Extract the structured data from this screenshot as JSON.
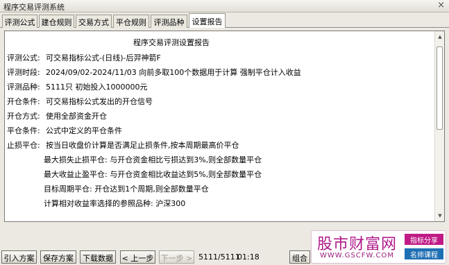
{
  "window": {
    "title": "程序交易评测系统",
    "close": "×"
  },
  "tabs": [
    {
      "label": "评测公式"
    },
    {
      "label": "建仓规则"
    },
    {
      "label": "交易方式"
    },
    {
      "label": "平仓规则"
    },
    {
      "label": "评测品种"
    },
    {
      "label": "设置报告"
    }
  ],
  "report": {
    "title": "程序交易评测设置报告",
    "lines": [
      {
        "label": "评测公式:",
        "value": "可交易指标公式-(日线)-后羿神箭F"
      },
      {
        "label": "评测时段:",
        "value": "2024/09/02-2024/11/03 向前多取100个数据用于计算 强制平仓计入收益"
      },
      {
        "label": "评测品种:",
        "value": "5111只 初始投入1000000元"
      },
      {
        "label": "开仓条件:",
        "value": "可交易指标公式发出的开仓信号"
      },
      {
        "label": "开仓方式:",
        "value": "使用全部资金开仓"
      },
      {
        "label": "平仓条件:",
        "value": "公式中定义的平仓条件"
      },
      {
        "label": "止损平仓:",
        "value": "按当日收盘价计算是否满足止损条件,按本周期最高价平仓"
      }
    ],
    "sub_lines": [
      "最大损失止损平仓: 与开仓资金相比亏损达到3%,则全部数量平仓",
      "最大收益止盈平仓: 与开仓资金相比收益达到5%,则全部数量平仓",
      "目标周期平仓: 开仓达到1个周期,则全部数量平仓",
      "计算相对收益率选择的参照品种: 沪深300"
    ]
  },
  "buttons": {
    "import": "引入方案",
    "save": "保存方案",
    "download": "下载数据",
    "prev": "< 上一步",
    "next": "下一步 >",
    "combine": "组合"
  },
  "status": {
    "count": "5111/5111",
    "time": "01:18"
  },
  "watermark": {
    "name": "股市财富网",
    "url": "WWW.GSCFW.COM",
    "tag1": "指标分享",
    "tag2": "名师课程"
  }
}
